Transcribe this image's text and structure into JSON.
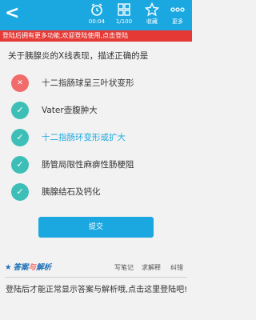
{
  "toolbar": {
    "back": "<",
    "timer": "00:04",
    "progress": "1/100",
    "favorite": "收藏",
    "more": "更多"
  },
  "login_banner": "登陆后拥有更多功能,欢迎登陆使用,点击登陆",
  "question": {
    "text": "关于胰腺炎的X线表现，描述正确的是",
    "options": [
      {
        "text": "十二指肠球呈三叶状变形",
        "status": "wrong"
      },
      {
        "text": "Vater壶腹肿大",
        "status": "checked"
      },
      {
        "text": "十二指肠环变形或扩大",
        "status": "correct"
      },
      {
        "text": "肠管局限性麻痹性肠梗阻",
        "status": "checked"
      },
      {
        "text": "胰腺结石及钙化",
        "status": "checked"
      }
    ],
    "submit_label": "提交"
  },
  "answer_section": {
    "title_part1": "答案",
    "title_part2": "与",
    "title_part3": "解析",
    "write_note": "写笔记",
    "ask_explain": "求解释",
    "report_error": "纠错",
    "login_tip": "登陆后才能正常显示答案与解析哦,点击这里登陆吧!"
  },
  "colors": {
    "primary": "#1ba8e0",
    "banner": "#e53935",
    "wrong": "#f26b6b",
    "ok": "#3dbfb7"
  }
}
